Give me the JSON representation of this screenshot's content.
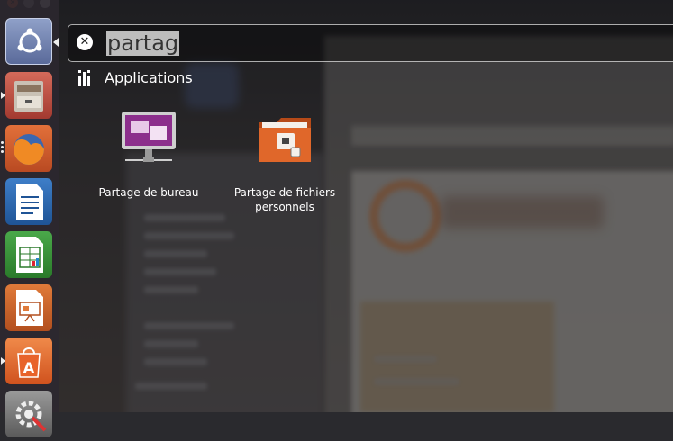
{
  "search": {
    "query": "partag"
  },
  "category": {
    "label": "Applications",
    "icon": "applications-category-icon"
  },
  "results": [
    {
      "label": "Partage de bureau",
      "icon": "desktop-sharing-icon"
    },
    {
      "label": "Partage de fichiers personnels",
      "icon": "personal-file-sharing-icon"
    }
  ],
  "launcher": {
    "items": [
      {
        "name": "ubuntu-dash",
        "icon": "ubuntu-logo-icon"
      },
      {
        "name": "file-manager",
        "icon": "file-cabinet-icon"
      },
      {
        "name": "firefox",
        "icon": "firefox-icon"
      },
      {
        "name": "libreoffice-writer",
        "icon": "writer-icon"
      },
      {
        "name": "libreoffice-calc",
        "icon": "calc-icon"
      },
      {
        "name": "libreoffice-impress",
        "icon": "impress-icon"
      },
      {
        "name": "software-center",
        "icon": "software-center-icon"
      },
      {
        "name": "system-settings",
        "icon": "settings-icon"
      }
    ]
  },
  "colors": {
    "accent": "#dd4814",
    "launcher_bg": "#2a262e"
  }
}
